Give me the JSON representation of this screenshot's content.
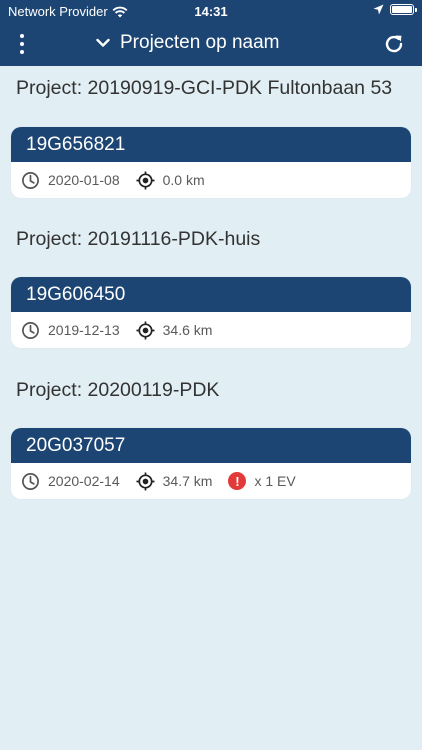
{
  "status_bar": {
    "carrier": "Network Provider",
    "time": "14:31"
  },
  "app_bar": {
    "title": "Projecten op naam"
  },
  "projects": [
    {
      "heading": "Project: 20190919-GCI-PDK Fultonbaan 53",
      "card": {
        "id": "19G656821",
        "date": "2020-01-08",
        "distance": "0.0 km",
        "warning": null
      }
    },
    {
      "heading": "Project: 20191116-PDK-huis",
      "card": {
        "id": "19G606450",
        "date": "2019-12-13",
        "distance": "34.6 km",
        "warning": null
      }
    },
    {
      "heading": "Project: 20200119-PDK",
      "card": {
        "id": "20G037057",
        "date": "2020-02-14",
        "distance": "34.7 km",
        "warning": "x 1 EV",
        "warning_icon_text": "!"
      }
    }
  ],
  "colors": {
    "primary": "#1c4573",
    "background": "#e1eef3",
    "warning": "#e23a3a"
  }
}
